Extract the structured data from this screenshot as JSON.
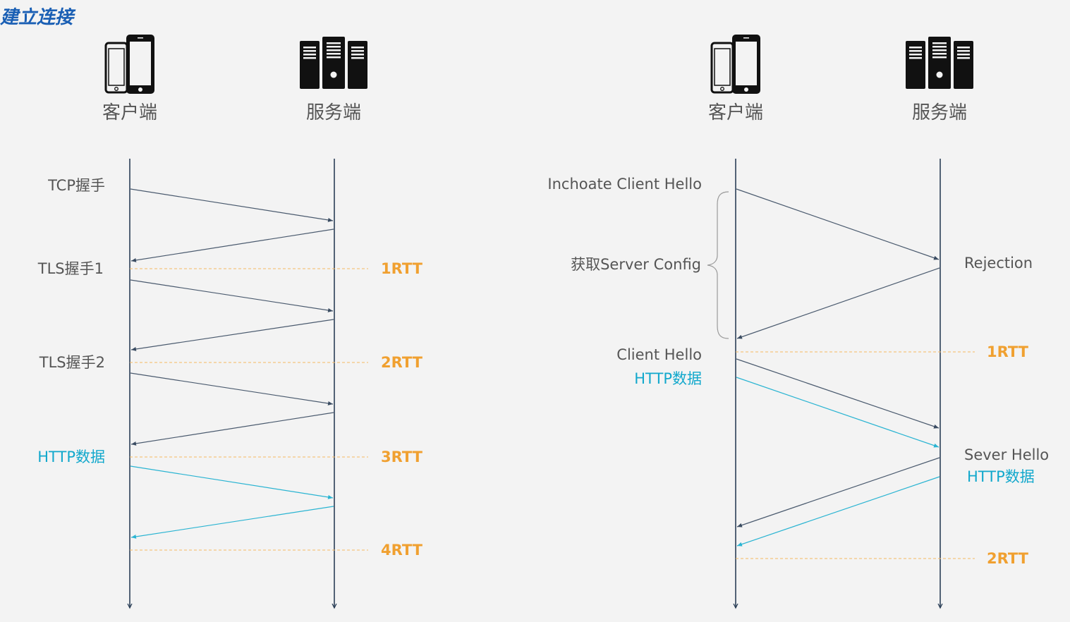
{
  "title": "建立连接",
  "colors": {
    "background": "#f3f3f3",
    "title": "#1a5fb4",
    "timeline": "#2b3f57",
    "arrow_dark": "#4a5a6e",
    "arrow_cyan": "#2ab4d2",
    "label_gray": "#555555",
    "label_cyan": "#12a8cc",
    "rtt_orange": "#f0a030",
    "rtt_line": "#f5b860",
    "brace": "#9a9a9a"
  },
  "left": {
    "client_label": "客户端",
    "server_label": "服务端",
    "client_icon": "phone-icon",
    "server_icon": "server-rack-icon",
    "steps": [
      "TCP握手",
      "TLS握手1",
      "TLS握手2",
      "HTTP数据"
    ],
    "rtt": [
      "1RTT",
      "2RTT",
      "3RTT",
      "4RTT"
    ]
  },
  "right": {
    "client_label": "客户端",
    "server_label": "服务端",
    "client_icon": "phone-icon",
    "server_icon": "server-rack-icon",
    "inchoate": "Inchoate Client Hello",
    "get_config": "获取Server Config",
    "rejection": "Rejection",
    "client_hello": "Client Hello",
    "client_http": "HTTP数据",
    "server_hello": "Sever Hello",
    "server_http": "HTTP数据",
    "rtt": [
      "1RTT",
      "2RTT"
    ]
  }
}
